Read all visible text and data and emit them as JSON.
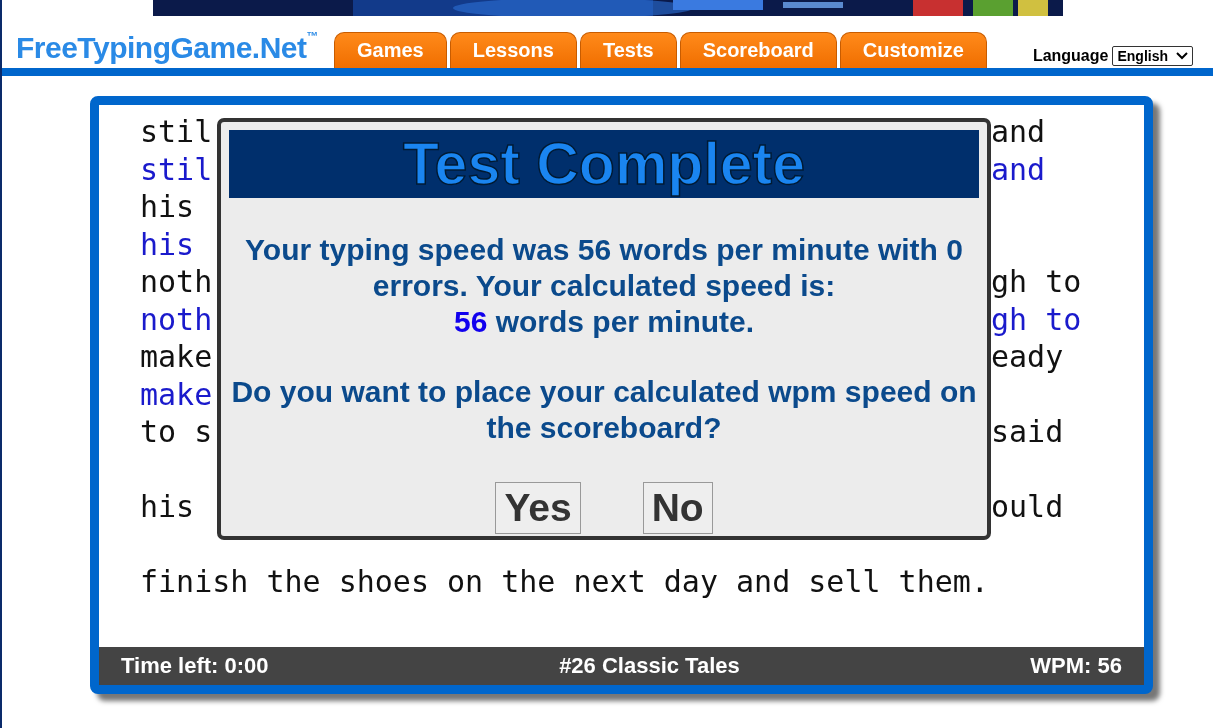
{
  "logo": {
    "name": "FreeTypingGame.Net",
    "mark": "™"
  },
  "nav_tabs": [
    {
      "label": "Games",
      "selected": false
    },
    {
      "label": "Lessons",
      "selected": false
    },
    {
      "label": "Tests",
      "selected": false
    },
    {
      "label": "Scoreboard",
      "selected": false
    },
    {
      "label": "Customize",
      "selected": false
    }
  ],
  "language": {
    "label": "Language",
    "value": "English"
  },
  "passage": {
    "lines": [
      {
        "kind": "text",
        "left": "stil",
        "right": "and",
        "typed": false
      },
      {
        "kind": "text",
        "left": "stil",
        "right": "and",
        "typed": true
      },
      {
        "kind": "text",
        "left": "his",
        "typed": false
      },
      {
        "kind": "text",
        "left": "his",
        "typed": true
      },
      {
        "kind": "text",
        "left": "noth",
        "right": "gh to",
        "typed": false
      },
      {
        "kind": "text",
        "left": "noth",
        "right": "gh to",
        "typed": true
      },
      {
        "kind": "text",
        "left": "make",
        "right": "eady",
        "typed": false
      },
      {
        "kind": "text",
        "left": "make",
        "typed": true
      },
      {
        "kind": "text",
        "left": "to s",
        "right": "said",
        "typed": false
      },
      {
        "kind": "blank"
      },
      {
        "kind": "text",
        "left": "his",
        "right": "ould",
        "typed": false
      },
      {
        "kind": "blank"
      },
      {
        "kind": "text",
        "left": "finish the shoes on the next day and sell them.",
        "typed": false
      }
    ]
  },
  "dialog": {
    "title": "Test Complete",
    "message": "Your typing speed was 56 words per minute with 0 errors. Your calculated speed is:",
    "result_value": "56",
    "result_unit": "words per minute.",
    "question": "Do you want to place your calculated wpm speed on the scoreboard?",
    "buttons": [
      "Yes",
      "No"
    ]
  },
  "status_bar": {
    "time_left": "Time left: 0:00",
    "test_name": "#26 Classic Tales",
    "wpm": "WPM: 56"
  }
}
